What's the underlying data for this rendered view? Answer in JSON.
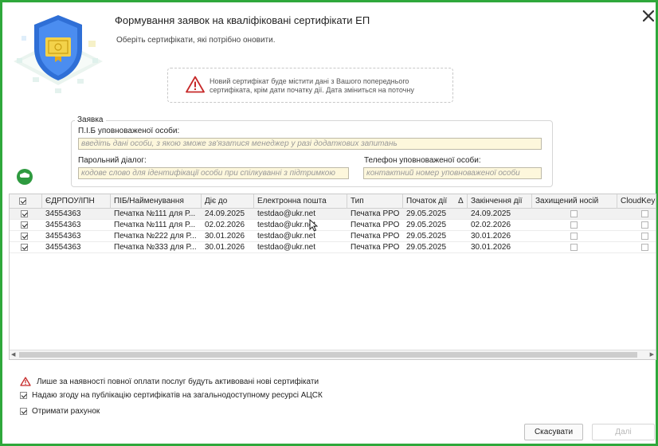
{
  "dialog": {
    "title": "Формування заявок на кваліфіковані сертифікати ЕП",
    "subtitle": "Оберіть сертифікати, які потрібно оновити.",
    "close_icon": "close-icon"
  },
  "warning": {
    "icon": "warning-icon",
    "text": "Новий сертифікат буде містити дані з Вашого попереднього сертифіката, крім дати початку дії. Дата зміниться на поточну"
  },
  "application": {
    "legend": "Заявка",
    "person_label": "П.І.Б уповноваженої особи:",
    "person_value": "",
    "person_placeholder": "введіть дані особи, з якою зможе зв'язатися менеджер у разі додаткових запитань",
    "password_label": "Парольний діалог:",
    "password_value": "",
    "password_placeholder": "кодове слово для ідентифікації особи при спілкуванні з підтримкою",
    "phone_label": "Телефон уповноваженої особи:",
    "phone_value": "",
    "phone_placeholder": "контактний номер уповноваженої особи"
  },
  "table": {
    "columns": [
      "ЄДРПОУ/ІПН",
      "ПІБ/Найменування",
      "Діє до",
      "Електронна пошта",
      "Тип",
      "Початок дії",
      "Закінчення дії",
      "Захищений носій",
      "CloudKey"
    ],
    "sort_indicator": "Δ",
    "header_checked": true,
    "rows": [
      {
        "checked": true,
        "code": "34554363",
        "name": "Печатка №111 для Р...",
        "valid_to": "24.09.2025",
        "email": "testdao@ukr.net",
        "type": "Печатка РРО",
        "start": "29.05.2025",
        "end": "24.09.2025",
        "secure": false,
        "cloudkey": false
      },
      {
        "checked": true,
        "code": "34554363",
        "name": "Печатка №111 для Р...",
        "valid_to": "02.02.2026",
        "email": "testdao@ukr.net",
        "type": "Печатка РРО",
        "start": "29.05.2025",
        "end": "02.02.2026",
        "secure": false,
        "cloudkey": false
      },
      {
        "checked": true,
        "code": "34554363",
        "name": "Печатка №222 для Р...",
        "valid_to": "30.01.2026",
        "email": "testdao@ukr.net",
        "type": "Печатка РРО",
        "start": "29.05.2025",
        "end": "30.01.2026",
        "secure": false,
        "cloudkey": false
      },
      {
        "checked": true,
        "code": "34554363",
        "name": "Печатка №333 для Р...",
        "valid_to": "30.01.2026",
        "email": "testdao@ukr.net",
        "type": "Печатка РРО",
        "start": "29.05.2025",
        "end": "30.01.2026",
        "secure": false,
        "cloudkey": false
      }
    ]
  },
  "footer": {
    "payment_notice": "Лише за наявності повної оплати послуг будуть активовані нові сертифікати",
    "consent_label": "Надаю згоду на публікацію сертифікатів на загальнодоступному ресурсі АЦСК",
    "consent_checked": true,
    "invoice_label": "Отримати рахунок",
    "invoice_checked": true,
    "cancel_label": "Скасувати",
    "next_label": "Далі"
  },
  "colors": {
    "frame": "#2fa83b",
    "field_bg": "#fdf7dc",
    "warning_red": "#c62828",
    "badge_green": "#2e9a3f",
    "shield_blue": "#2f6fd6"
  }
}
